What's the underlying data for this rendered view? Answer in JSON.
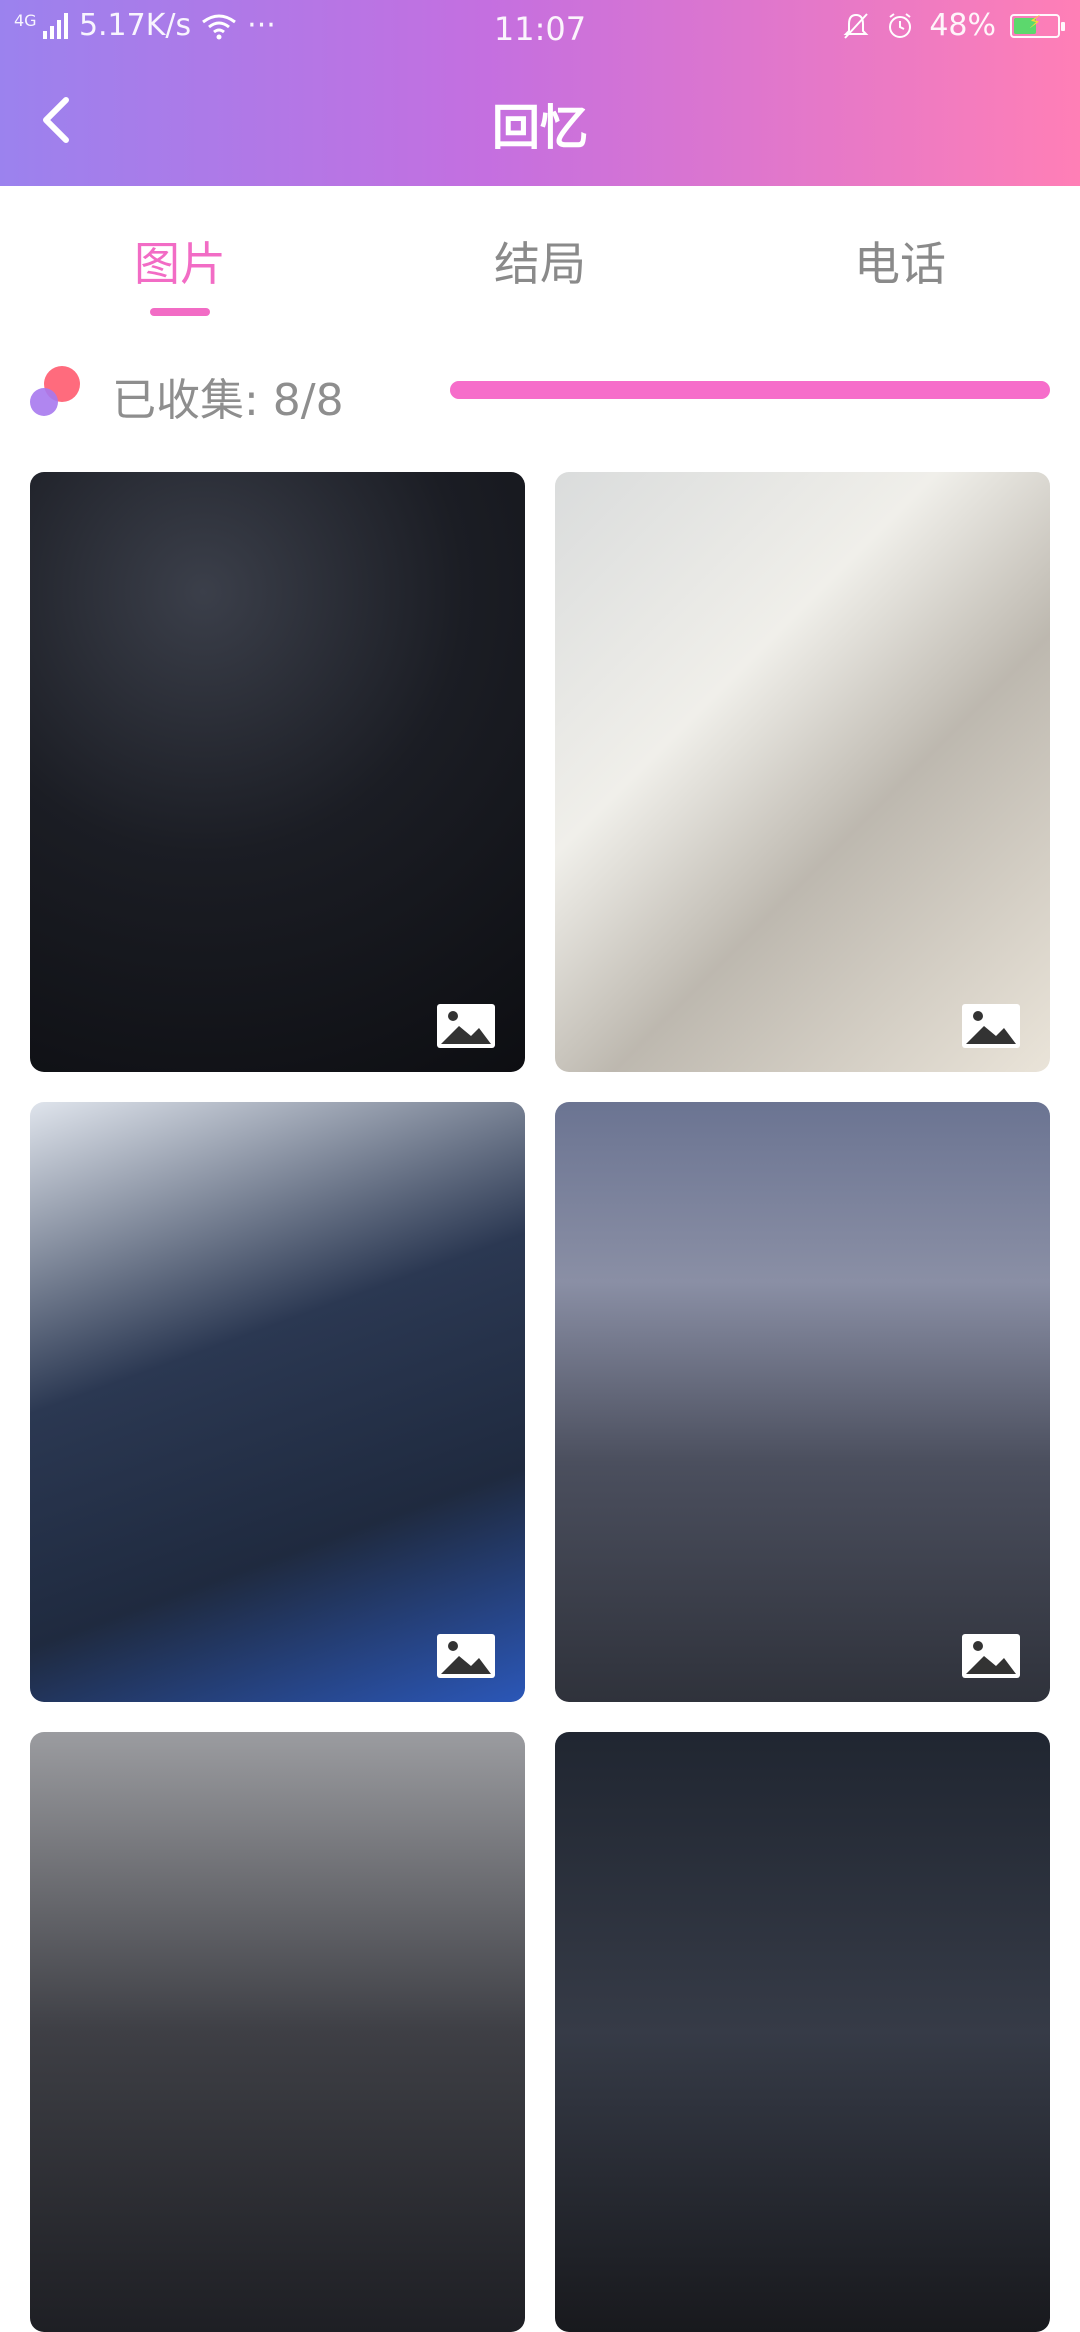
{
  "status_bar": {
    "network": "4G",
    "speed": "5.17K/s",
    "more": "···",
    "time": "11:07",
    "battery": "48%"
  },
  "nav": {
    "title": "回忆"
  },
  "tabs": [
    {
      "label": "图片",
      "active": true
    },
    {
      "label": "结局",
      "active": false
    },
    {
      "label": "电话",
      "active": false
    }
  ],
  "collection": {
    "label": "已收集: 8/8",
    "progress_fraction": 1.0
  },
  "colors": {
    "accent": "#f26cc5",
    "header_gradient_start": "#9b82ee",
    "header_gradient_end": "#ff7fb6"
  },
  "photos": [
    {
      "icon": "image-icon"
    },
    {
      "icon": "image-icon"
    },
    {
      "icon": "image-icon"
    },
    {
      "icon": "image-icon"
    },
    {
      "icon": "image-icon"
    },
    {
      "icon": "image-icon"
    }
  ]
}
